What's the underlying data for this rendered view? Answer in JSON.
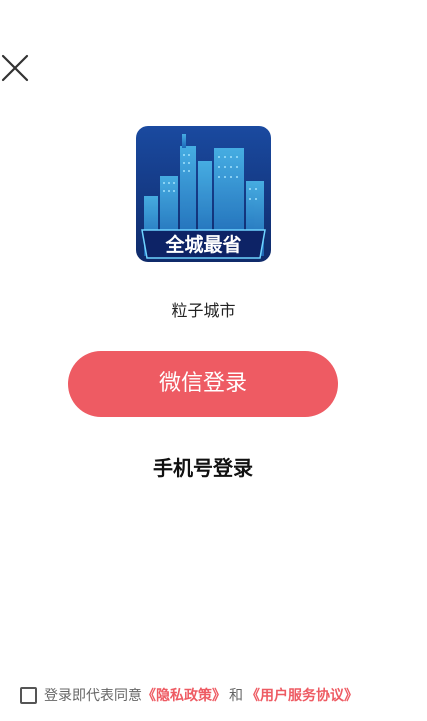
{
  "header": {
    "close_icon": "close-icon"
  },
  "app": {
    "logo_text": "全城最省",
    "name": "粒子城市"
  },
  "login": {
    "wechat_label": "微信登录",
    "phone_label": "手机号登录"
  },
  "agreement": {
    "checked": false,
    "prefix": "登录即代表同意",
    "privacy_link": "《隐私政策》",
    "and": "和",
    "service_link": "《用户服务协议》"
  },
  "colors": {
    "accent": "#ee5b63",
    "logo_bg": "#1b3f8f"
  }
}
